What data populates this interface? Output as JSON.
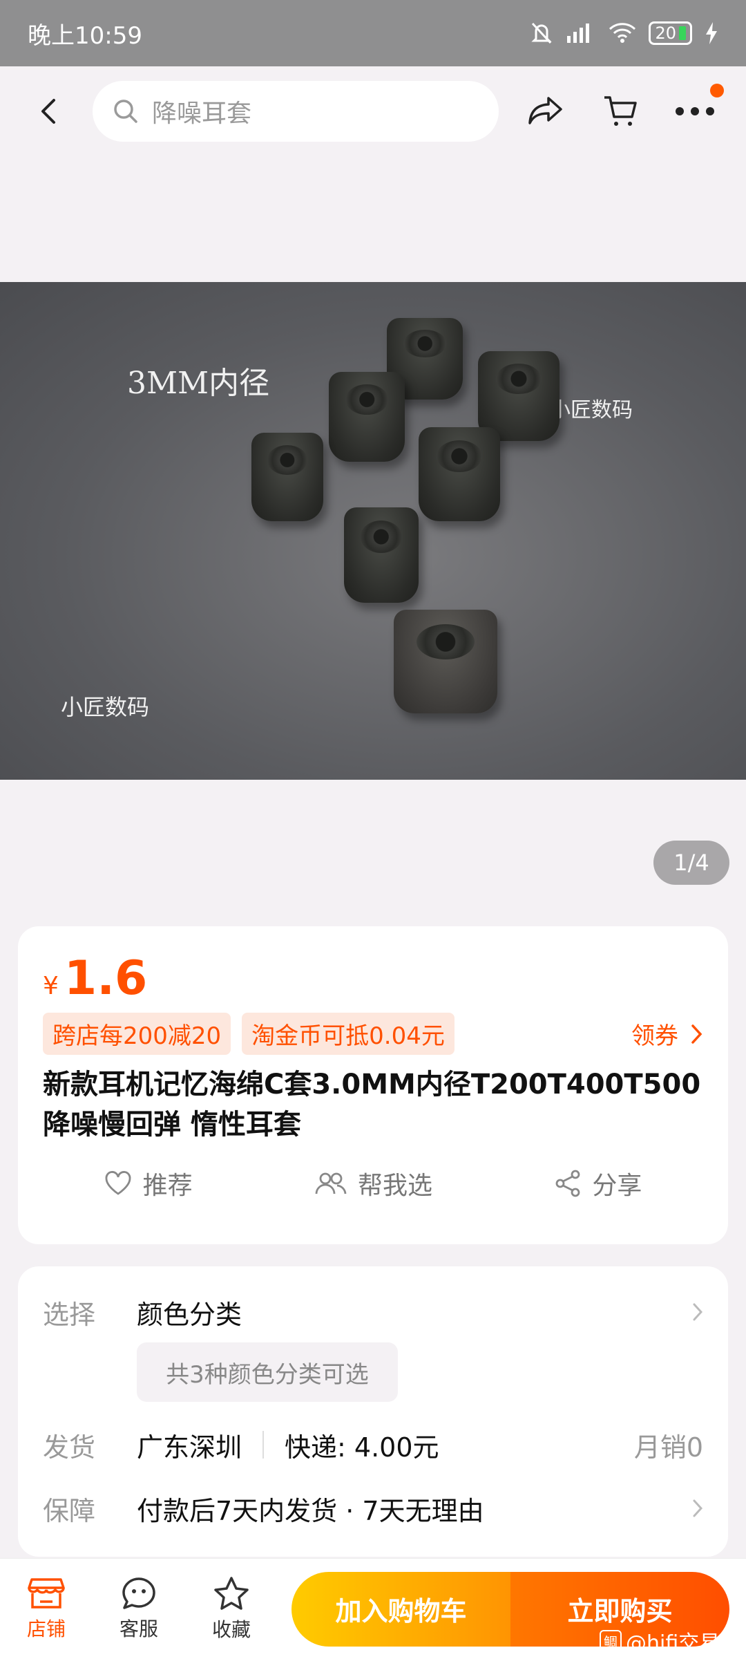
{
  "status_bar": {
    "time": "晚上10:59",
    "battery": "20",
    "network": "6"
  },
  "header": {
    "search_placeholder": "降噪耳套"
  },
  "product_image": {
    "caption": "3MM内径",
    "watermark_1": "小匠数码",
    "watermark_2": "小匠数码",
    "page_indicator": "1/4"
  },
  "price": {
    "symbol": "¥",
    "value": "1.6"
  },
  "promos": {
    "tag1": "跨店每200减20",
    "tag2": "淘金币可抵0.04元",
    "coupon": "领券"
  },
  "product_title": "新款耳机记忆海绵C套3.0MM内径T200T400T500降噪慢回弹 惰性耳套",
  "actions": {
    "recommend": "推荐",
    "help_choose": "帮我选",
    "share": "分享"
  },
  "details": {
    "select_label": "选择",
    "select_value": "颜色分类",
    "color_chip": "共3种颜色分类可选",
    "ship_label": "发货",
    "ship_from": "广东深圳",
    "shipping_fee": "快递: 4.00元",
    "monthly_sales": "月销0",
    "guarantee_label": "保障",
    "guarantee_value": "付款后7天内发货 · 7天无理由"
  },
  "bottom_bar": {
    "shop": "店铺",
    "service": "客服",
    "favorite": "收藏",
    "add_to_cart": "加入购物车",
    "buy_now": "立即购买"
  },
  "watermark": {
    "badge": "鲷",
    "text": "@hifi交易"
  },
  "colors": {
    "accent": "#ff5000",
    "cart_gradient": [
      "#ffcb00",
      "#ff9402"
    ],
    "buy_gradient": [
      "#ff7700",
      "#ff4e00"
    ]
  }
}
